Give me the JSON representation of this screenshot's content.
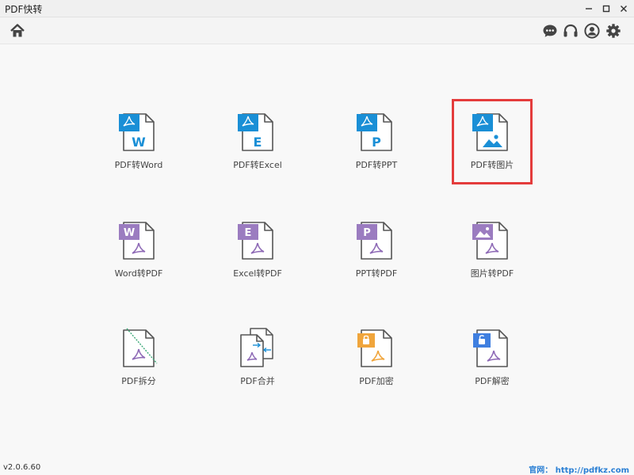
{
  "window": {
    "title": "PDF快转",
    "minimize_glyph": "✕",
    "maximize_glyph": "□",
    "close_glyph": "✕"
  },
  "toolbar": {
    "left_icons": [
      "home-icon"
    ],
    "right_icons": [
      "chat-icon",
      "headset-icon",
      "user-icon",
      "gear-icon"
    ]
  },
  "tools": {
    "row1": [
      {
        "label": "PDF转Word",
        "letter": "W"
      },
      {
        "label": "PDF转Excel",
        "letter": "E"
      },
      {
        "label": "PDF转PPT",
        "letter": "P"
      },
      {
        "label": "PDF转图片",
        "letter": ""
      }
    ],
    "row2": [
      {
        "label": "Word转PDF",
        "letter": "W"
      },
      {
        "label": "Excel转PDF",
        "letter": "E"
      },
      {
        "label": "PPT转PDF",
        "letter": "P"
      },
      {
        "label": "图片转PDF",
        "letter": ""
      }
    ],
    "row3": [
      {
        "label": "PDF拆分"
      },
      {
        "label": "PDF合并"
      },
      {
        "label": "PDF加密"
      },
      {
        "label": "PDF解密"
      }
    ]
  },
  "selected_tool": "PDF转图片",
  "status": {
    "version": "v2.0.6.60",
    "site_link": "官网：  http://pdfkz.com"
  },
  "colors": {
    "pdf_blue": "#1a8fd6",
    "office_purple": "#9b7cc0",
    "acrobat_purple": "#8e6ab6",
    "split_green": "#3aa876",
    "lock_orange": "#f0a53c",
    "unlock_blue": "#3f7fe0",
    "highlight_red": "#e43c3c"
  }
}
